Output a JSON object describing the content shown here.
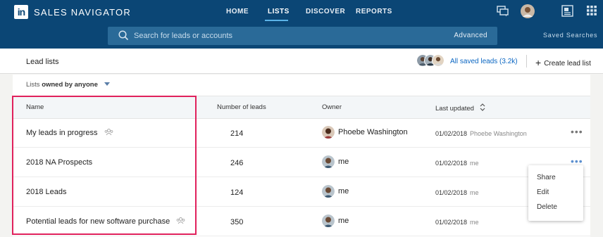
{
  "header": {
    "logo_text": "in",
    "brand": "SALES NAVIGATOR",
    "nav": [
      {
        "label": "HOME",
        "active": false
      },
      {
        "label": "LISTS",
        "active": true
      },
      {
        "label": "DISCOVER",
        "active": false
      },
      {
        "label": "REPORTS",
        "active": false
      }
    ],
    "search": {
      "placeholder": "Search for leads or accounts",
      "advanced_label": "Advanced"
    },
    "saved_searches_label": "Saved Searches",
    "icons": [
      "messaging-icon",
      "profile-avatar",
      "notes-icon",
      "apps-grid-icon"
    ],
    "accent_color": "#0b4675"
  },
  "subheader": {
    "title": "Lead lists",
    "saved_leads_label": "All saved leads (3.2k)",
    "create_list_label": "Create lead list"
  },
  "filter": {
    "prefix": "Lists",
    "value": "owned by anyone"
  },
  "table": {
    "columns": [
      "Name",
      "Number of leads",
      "Owner",
      "Last updated"
    ],
    "rows": [
      {
        "name": "My leads in progress",
        "shared": true,
        "count": "214",
        "owner": "Phoebe Washington",
        "updated": "01/02/2018",
        "updated_by": "Phoebe Washington"
      },
      {
        "name": "2018 NA Prospects",
        "shared": false,
        "count": "246",
        "owner": "me",
        "updated": "01/02/2018",
        "updated_by": "me"
      },
      {
        "name": "2018 Leads",
        "shared": false,
        "count": "124",
        "owner": "me",
        "updated": "01/02/2018",
        "updated_by": "me"
      },
      {
        "name": "Potential leads for new software purchase",
        "shared": true,
        "count": "350",
        "owner": "me",
        "updated": "01/02/2018",
        "updated_by": "me"
      }
    ]
  },
  "row_menu": {
    "items": [
      "Share",
      "Edit",
      "Delete"
    ]
  },
  "colors": {
    "highlight": "#e0215c",
    "link": "#0a66c2"
  }
}
